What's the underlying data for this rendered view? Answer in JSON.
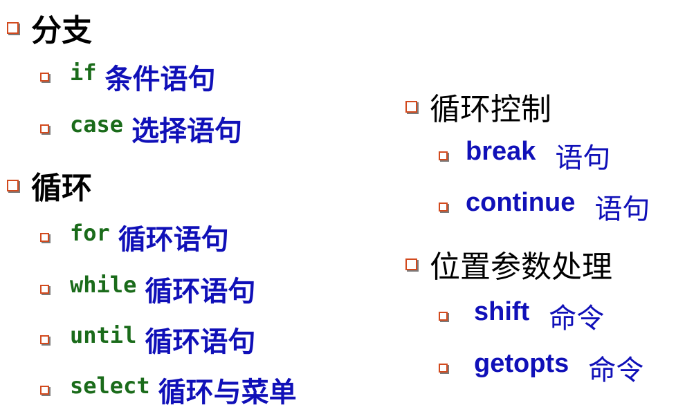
{
  "left_column": {
    "branch": {
      "heading": "分支",
      "items": [
        {
          "code": "if",
          "text": "条件语句"
        },
        {
          "code": "case",
          "text": "选择语句"
        }
      ]
    },
    "loop": {
      "heading": "循环",
      "items": [
        {
          "code": "for",
          "text": "循环语句"
        },
        {
          "code": "while",
          "text": "循环语句"
        },
        {
          "code": "until",
          "text": "循环语句"
        },
        {
          "code": "select",
          "text": "循环与菜单"
        }
      ]
    }
  },
  "right_column": {
    "loop_control": {
      "heading": "循环控制",
      "items": [
        {
          "keyword": "break",
          "text": "语句"
        },
        {
          "keyword": "continue",
          "text": "语句"
        }
      ]
    },
    "positional_params": {
      "heading": "位置参数处理",
      "items": [
        {
          "keyword": "shift",
          "text": "命令"
        },
        {
          "keyword": "getopts",
          "text": "命令"
        }
      ]
    }
  },
  "colors": {
    "bullet_border": "#d24a1e",
    "code_green": "#1a6b1a",
    "text_blue": "#1010b8",
    "heading_black": "#000000"
  },
  "icons": {
    "level1_bullet": "hollow-square-bullet-icon",
    "level2_bullet": "hollow-square-bullet-icon"
  }
}
